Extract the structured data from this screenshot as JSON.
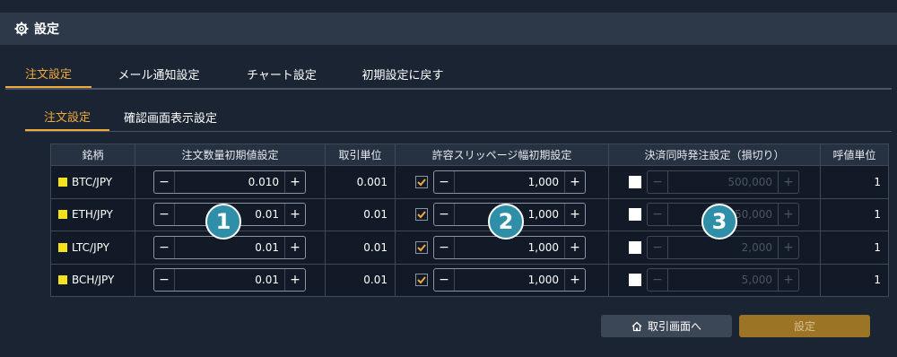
{
  "header": {
    "title": "設定"
  },
  "tabs_main": [
    {
      "label": "注文設定",
      "active": true
    },
    {
      "label": "メール通知設定",
      "active": false
    },
    {
      "label": "チャート設定",
      "active": false
    },
    {
      "label": "初期設定に戻す",
      "active": false
    }
  ],
  "tabs_sub": [
    {
      "label": "注文設定",
      "active": true
    },
    {
      "label": "確認画面表示設定",
      "active": false
    }
  ],
  "table": {
    "headers": [
      "銘柄",
      "注文数量初期値設定",
      "取引単位",
      "許容スリッページ幅初期設定",
      "決済同時発注設定（損切り）",
      "呼値単位"
    ],
    "rows": [
      {
        "symbol": "BTC/JPY",
        "qty": "0.010",
        "unit": "0.001",
        "slip_checked": true,
        "slip": "1,000",
        "stop_checked": false,
        "stop": "500,000",
        "tick": "1"
      },
      {
        "symbol": "ETH/JPY",
        "qty": "0.01",
        "unit": "0.01",
        "slip_checked": true,
        "slip": "1,000",
        "stop_checked": false,
        "stop": "50,000",
        "tick": "1"
      },
      {
        "symbol": "LTC/JPY",
        "qty": "0.01",
        "unit": "0.01",
        "slip_checked": true,
        "slip": "1,000",
        "stop_checked": false,
        "stop": "2,000",
        "tick": "1"
      },
      {
        "symbol": "BCH/JPY",
        "qty": "0.01",
        "unit": "0.01",
        "slip_checked": true,
        "slip": "1,000",
        "stop_checked": false,
        "stop": "5,000",
        "tick": "1"
      }
    ],
    "minus": "−",
    "plus": "+"
  },
  "badges": [
    "1",
    "2",
    "3"
  ],
  "buttons": {
    "home": "取引画面へ",
    "set": "設定"
  },
  "colors": {
    "accent": "#f0a93b",
    "symbol_dot": "#f5e21d",
    "badge": "#2f8fa8",
    "set_button": "#9c7426"
  }
}
